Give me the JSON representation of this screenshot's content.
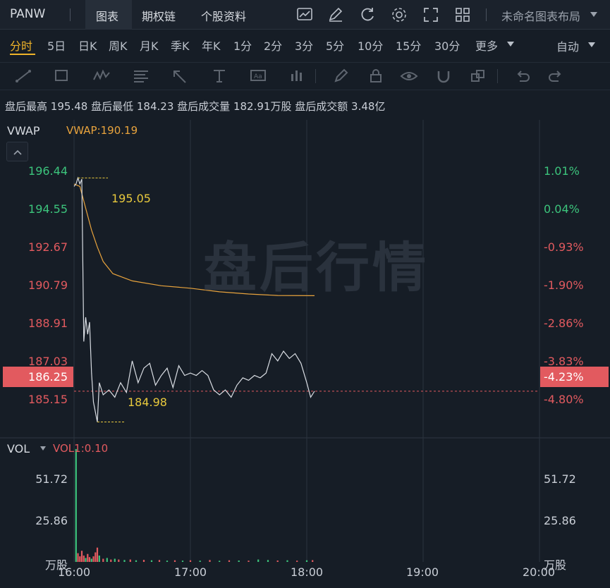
{
  "topbar": {
    "symbol": "PANW",
    "tabs": [
      "图表",
      "期权链",
      "个股资料"
    ],
    "active_tab": "图表",
    "layout_name": "未命名图表布局"
  },
  "periods": [
    "分时",
    "5日",
    "日K",
    "周K",
    "月K",
    "季K",
    "年K",
    "1分",
    "2分",
    "3分",
    "5分",
    "10分",
    "15分",
    "30分",
    "更多"
  ],
  "active_period": "分时",
  "auto_label": "自动",
  "info": {
    "high_label": "盘后最高",
    "high": "195.48",
    "low_label": "盘后最低",
    "low": "184.23",
    "vol_label": "盘后成交量",
    "vol": "182.91万股",
    "amt_label": "盘后成交额",
    "amt": "3.48亿"
  },
  "watermark": "盘后行情",
  "chart_data": {
    "type": "line",
    "price_panel": {
      "indicator_label": "VWAP",
      "indicator_value": "VWAP:190.19",
      "price_ticks": [
        "196.44",
        "194.55",
        "192.67",
        "190.79",
        "188.91",
        "187.03",
        "185.15"
      ],
      "pct_ticks": [
        "1.01%",
        "0.04%",
        "-0.93%",
        "-1.90%",
        "-2.86%",
        "-3.83%",
        "-4.80%"
      ],
      "current_price": "186.25",
      "current_pct": "-4.23%",
      "high_marker": "195.05",
      "low_marker": "184.98",
      "price_series": [
        {
          "x": "16:00",
          "y": 194.7
        },
        {
          "x": "16:01",
          "y": 194.8
        },
        {
          "x": "16:02",
          "y": 195.05
        },
        {
          "x": "16:03",
          "y": 194.8
        },
        {
          "x": "16:04",
          "y": 195.0
        },
        {
          "x": "16:05",
          "y": 188.3
        },
        {
          "x": "16:06",
          "y": 189.3
        },
        {
          "x": "16:07",
          "y": 188.6
        },
        {
          "x": "16:08",
          "y": 189.1
        },
        {
          "x": "16:09",
          "y": 187.0
        },
        {
          "x": "16:10",
          "y": 185.8
        },
        {
          "x": "16:12",
          "y": 184.98
        },
        {
          "x": "16:13",
          "y": 186.6
        },
        {
          "x": "16:15",
          "y": 186.1
        },
        {
          "x": "16:18",
          "y": 186.3
        },
        {
          "x": "16:21",
          "y": 186.0
        },
        {
          "x": "16:24",
          "y": 186.6
        },
        {
          "x": "16:27",
          "y": 186.2
        },
        {
          "x": "16:30",
          "y": 187.5
        },
        {
          "x": "16:33",
          "y": 186.6
        },
        {
          "x": "16:36",
          "y": 187.2
        },
        {
          "x": "16:39",
          "y": 187.4
        },
        {
          "x": "16:42",
          "y": 186.5
        },
        {
          "x": "16:45",
          "y": 186.9
        },
        {
          "x": "16:48",
          "y": 187.2
        },
        {
          "x": "16:51",
          "y": 186.4
        },
        {
          "x": "16:54",
          "y": 187.3
        },
        {
          "x": "16:57",
          "y": 186.9
        },
        {
          "x": "17:00",
          "y": 187.0
        },
        {
          "x": "17:03",
          "y": 186.9
        },
        {
          "x": "17:06",
          "y": 187.1
        },
        {
          "x": "17:09",
          "y": 186.9
        },
        {
          "x": "17:12",
          "y": 186.3
        },
        {
          "x": "17:15",
          "y": 186.1
        },
        {
          "x": "17:18",
          "y": 186.3
        },
        {
          "x": "17:21",
          "y": 186.0
        },
        {
          "x": "17:24",
          "y": 186.5
        },
        {
          "x": "17:27",
          "y": 186.8
        },
        {
          "x": "17:30",
          "y": 186.7
        },
        {
          "x": "17:33",
          "y": 186.9
        },
        {
          "x": "17:36",
          "y": 186.8
        },
        {
          "x": "17:39",
          "y": 187.0
        },
        {
          "x": "17:42",
          "y": 187.8
        },
        {
          "x": "17:45",
          "y": 187.5
        },
        {
          "x": "17:48",
          "y": 187.9
        },
        {
          "x": "17:51",
          "y": 187.6
        },
        {
          "x": "17:54",
          "y": 187.8
        },
        {
          "x": "17:57",
          "y": 187.4
        },
        {
          "x": "18:00",
          "y": 186.6
        },
        {
          "x": "18:02",
          "y": 186.0
        },
        {
          "x": "18:04",
          "y": 186.25
        }
      ],
      "vwap_series": [
        {
          "x": "16:00",
          "y": 194.8
        },
        {
          "x": "16:03",
          "y": 194.7
        },
        {
          "x": "16:06",
          "y": 193.8
        },
        {
          "x": "16:09",
          "y": 192.9
        },
        {
          "x": "16:12",
          "y": 192.2
        },
        {
          "x": "16:15",
          "y": 191.6
        },
        {
          "x": "16:20",
          "y": 191.1
        },
        {
          "x": "16:30",
          "y": 190.8
        },
        {
          "x": "16:45",
          "y": 190.6
        },
        {
          "x": "17:00",
          "y": 190.5
        },
        {
          "x": "17:15",
          "y": 190.35
        },
        {
          "x": "17:30",
          "y": 190.26
        },
        {
          "x": "17:45",
          "y": 190.2
        },
        {
          "x": "18:04",
          "y": 190.19
        }
      ],
      "ylim": [
        184.5,
        197.3
      ]
    },
    "volume_panel": {
      "indicator_label": "VOL",
      "indicator_value": "VOL1:0.10",
      "ticks": [
        "51.72",
        "25.86"
      ],
      "unit": "万股",
      "volume": [
        {
          "x": "16:01",
          "v": 71.0,
          "up": true
        },
        {
          "x": "16:02",
          "v": 5.5,
          "up": false
        },
        {
          "x": "16:03",
          "v": 3.5,
          "up": false
        },
        {
          "x": "16:04",
          "v": 7.0,
          "up": false
        },
        {
          "x": "16:05",
          "v": 4.0,
          "up": false
        },
        {
          "x": "16:06",
          "v": 2.5,
          "up": true
        },
        {
          "x": "16:07",
          "v": 5.0,
          "up": false
        },
        {
          "x": "16:08",
          "v": 3.0,
          "up": false
        },
        {
          "x": "16:09",
          "v": 2.0,
          "up": true
        },
        {
          "x": "16:10",
          "v": 3.5,
          "up": false
        },
        {
          "x": "16:11",
          "v": 6.0,
          "up": false
        },
        {
          "x": "16:12",
          "v": 9.0,
          "up": false
        },
        {
          "x": "16:13",
          "v": 4.0,
          "up": true
        },
        {
          "x": "16:15",
          "v": 2.0,
          "up": false
        },
        {
          "x": "16:17",
          "v": 2.5,
          "up": true
        },
        {
          "x": "16:19",
          "v": 1.5,
          "up": false
        },
        {
          "x": "16:21",
          "v": 2.0,
          "up": true
        },
        {
          "x": "16:23",
          "v": 1.5,
          "up": false
        },
        {
          "x": "16:26",
          "v": 1.2,
          "up": true
        },
        {
          "x": "16:29",
          "v": 1.5,
          "up": false
        },
        {
          "x": "16:32",
          "v": 1.0,
          "up": true
        },
        {
          "x": "16:36",
          "v": 1.3,
          "up": false
        },
        {
          "x": "16:40",
          "v": 1.0,
          "up": true
        },
        {
          "x": "16:44",
          "v": 1.2,
          "up": false
        },
        {
          "x": "16:48",
          "v": 0.8,
          "up": true
        },
        {
          "x": "16:52",
          "v": 1.0,
          "up": false
        },
        {
          "x": "16:56",
          "v": 0.8,
          "up": true
        },
        {
          "x": "17:00",
          "v": 1.0,
          "up": false
        },
        {
          "x": "17:05",
          "v": 0.8,
          "up": true
        },
        {
          "x": "17:10",
          "v": 1.2,
          "up": false
        },
        {
          "x": "17:15",
          "v": 0.7,
          "up": true
        },
        {
          "x": "17:20",
          "v": 1.0,
          "up": false
        },
        {
          "x": "17:25",
          "v": 0.9,
          "up": true
        },
        {
          "x": "17:30",
          "v": 0.8,
          "up": false
        },
        {
          "x": "17:35",
          "v": 1.5,
          "up": true
        },
        {
          "x": "17:40",
          "v": 1.2,
          "up": true
        },
        {
          "x": "17:45",
          "v": 0.9,
          "up": false
        },
        {
          "x": "17:50",
          "v": 1.0,
          "up": true
        },
        {
          "x": "17:55",
          "v": 0.8,
          "up": false
        },
        {
          "x": "18:00",
          "v": 1.0,
          "up": true
        },
        {
          "x": "18:03",
          "v": 1.1,
          "up": false
        }
      ],
      "ylim": [
        0,
        77.6
      ]
    },
    "x_ticks": [
      "16:00",
      "17:00",
      "18:00",
      "19:00",
      "20:00"
    ],
    "x_range": [
      "16:00",
      "20:00"
    ],
    "colors": {
      "price_line": "#d9dde3",
      "vwap_line": "#e8a33d",
      "up": "#3cc47c",
      "down": "#e25a5f",
      "marker": "#e8c93d",
      "grid": "#2b333f"
    }
  }
}
